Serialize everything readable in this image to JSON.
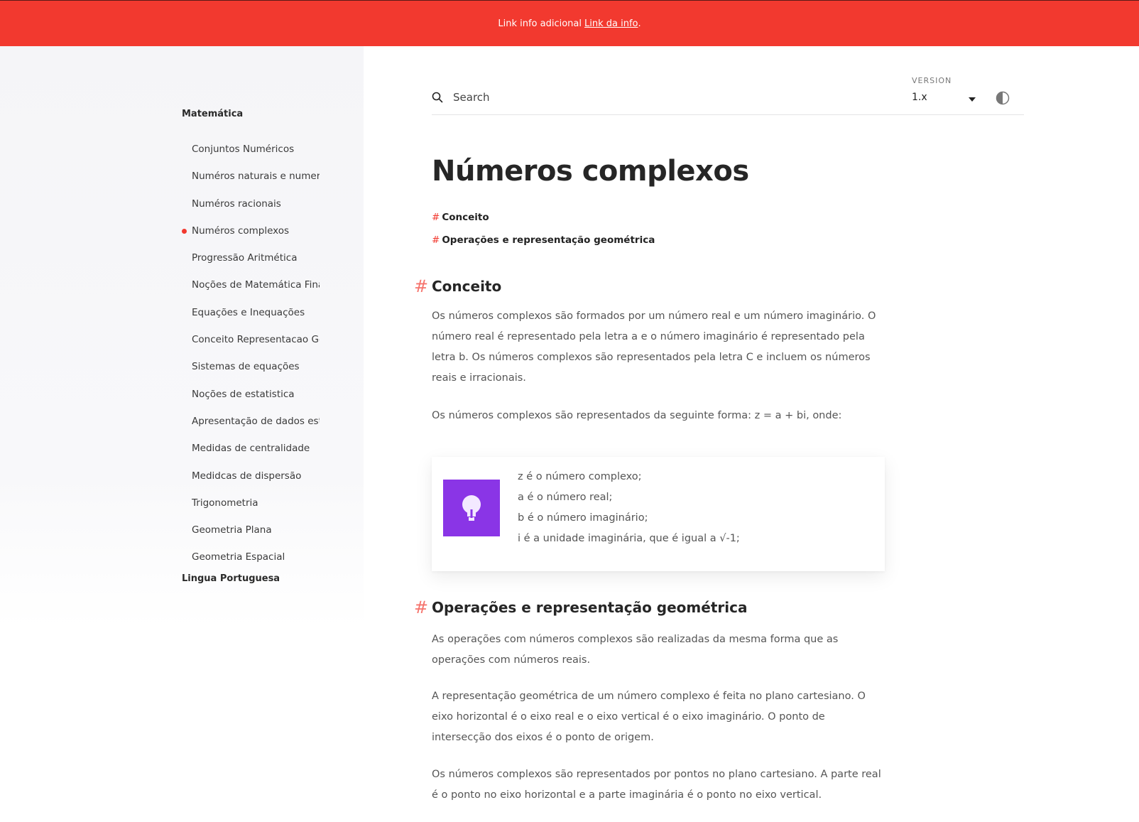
{
  "banner": {
    "text": "Link info adicional",
    "link_label": "Link da info",
    "suffix": "."
  },
  "sidebar": {
    "group_math": "Matemática",
    "items": [
      {
        "label": "Conjuntos Numéricos",
        "active": false
      },
      {
        "label": "Numéros naturais e numeros inteiros",
        "active": false
      },
      {
        "label": "Numéros racionais",
        "active": false
      },
      {
        "label": "Numéros complexos",
        "active": true
      },
      {
        "label": "Progressão Aritmética",
        "active": false
      },
      {
        "label": "Noções de Matemática Financeira",
        "active": false
      },
      {
        "label": "Equações e Inequações",
        "active": false
      },
      {
        "label": "Conceito Representacao Geometrica",
        "active": false
      },
      {
        "label": "Sistemas de equações",
        "active": false
      },
      {
        "label": "Noções de estatistica",
        "active": false
      },
      {
        "label": "Apresentação de dados estatisticos",
        "active": false
      },
      {
        "label": "Medidas de centralidade",
        "active": false
      },
      {
        "label": "Medidcas de dispersão",
        "active": false
      },
      {
        "label": "Trigonometria",
        "active": false
      },
      {
        "label": "Geometria Plana",
        "active": false
      },
      {
        "label": "Geometria Espacial",
        "active": false
      }
    ],
    "group_portuguese": "Lingua Portuguesa"
  },
  "header": {
    "search_placeholder": "Search",
    "version_label": "VERSION",
    "version_value": "1.x",
    "icons": {
      "search": "search-icon",
      "theme": "contrast-icon",
      "caret": "caret-down-icon"
    }
  },
  "page": {
    "title": "Números complexos",
    "toc": [
      {
        "hash": "#",
        "label": "Conceito"
      },
      {
        "hash": "#",
        "label": "Operações e representação geométrica"
      }
    ],
    "section1": {
      "anchor": "#",
      "heading": "Conceito",
      "para1": "Os números complexos são formados por um número real e um número imaginário. O número real é representado pela letra a e o número imaginário é representado pela letra b. Os números complexos são representados pela letra C e incluem os números reais e irracionais.",
      "para2": "Os números complexos são representados da seguinte forma: z = a + bi, onde:"
    },
    "callout": {
      "icon": "lightbulb-icon",
      "icon_color": "#8a35e6",
      "lines": [
        "z é o número complexo;",
        "a é o número real;",
        "b é o número imaginário;",
        "i é a unidade imaginária, que é igual a √-1;"
      ]
    },
    "section2": {
      "anchor": "#",
      "heading": "Operações e representação geométrica",
      "para1": "As operações com números complexos são realizadas da mesma forma que as operações com números reais.",
      "para2": "A representação geométrica de um número complexo é feita no plano cartesiano. O eixo horizontal é o eixo real e o eixo vertical é o eixo imaginário. O ponto de intersecção dos eixos é o ponto de origem.",
      "para3": "Os números complexos são representados por pontos no plano cartesiano. A parte real é o ponto no eixo horizontal e a parte imaginária é o ponto no eixo vertical."
    }
  },
  "colors": {
    "accent": "#f2392f",
    "callout_icon": "#8a35e6"
  }
}
